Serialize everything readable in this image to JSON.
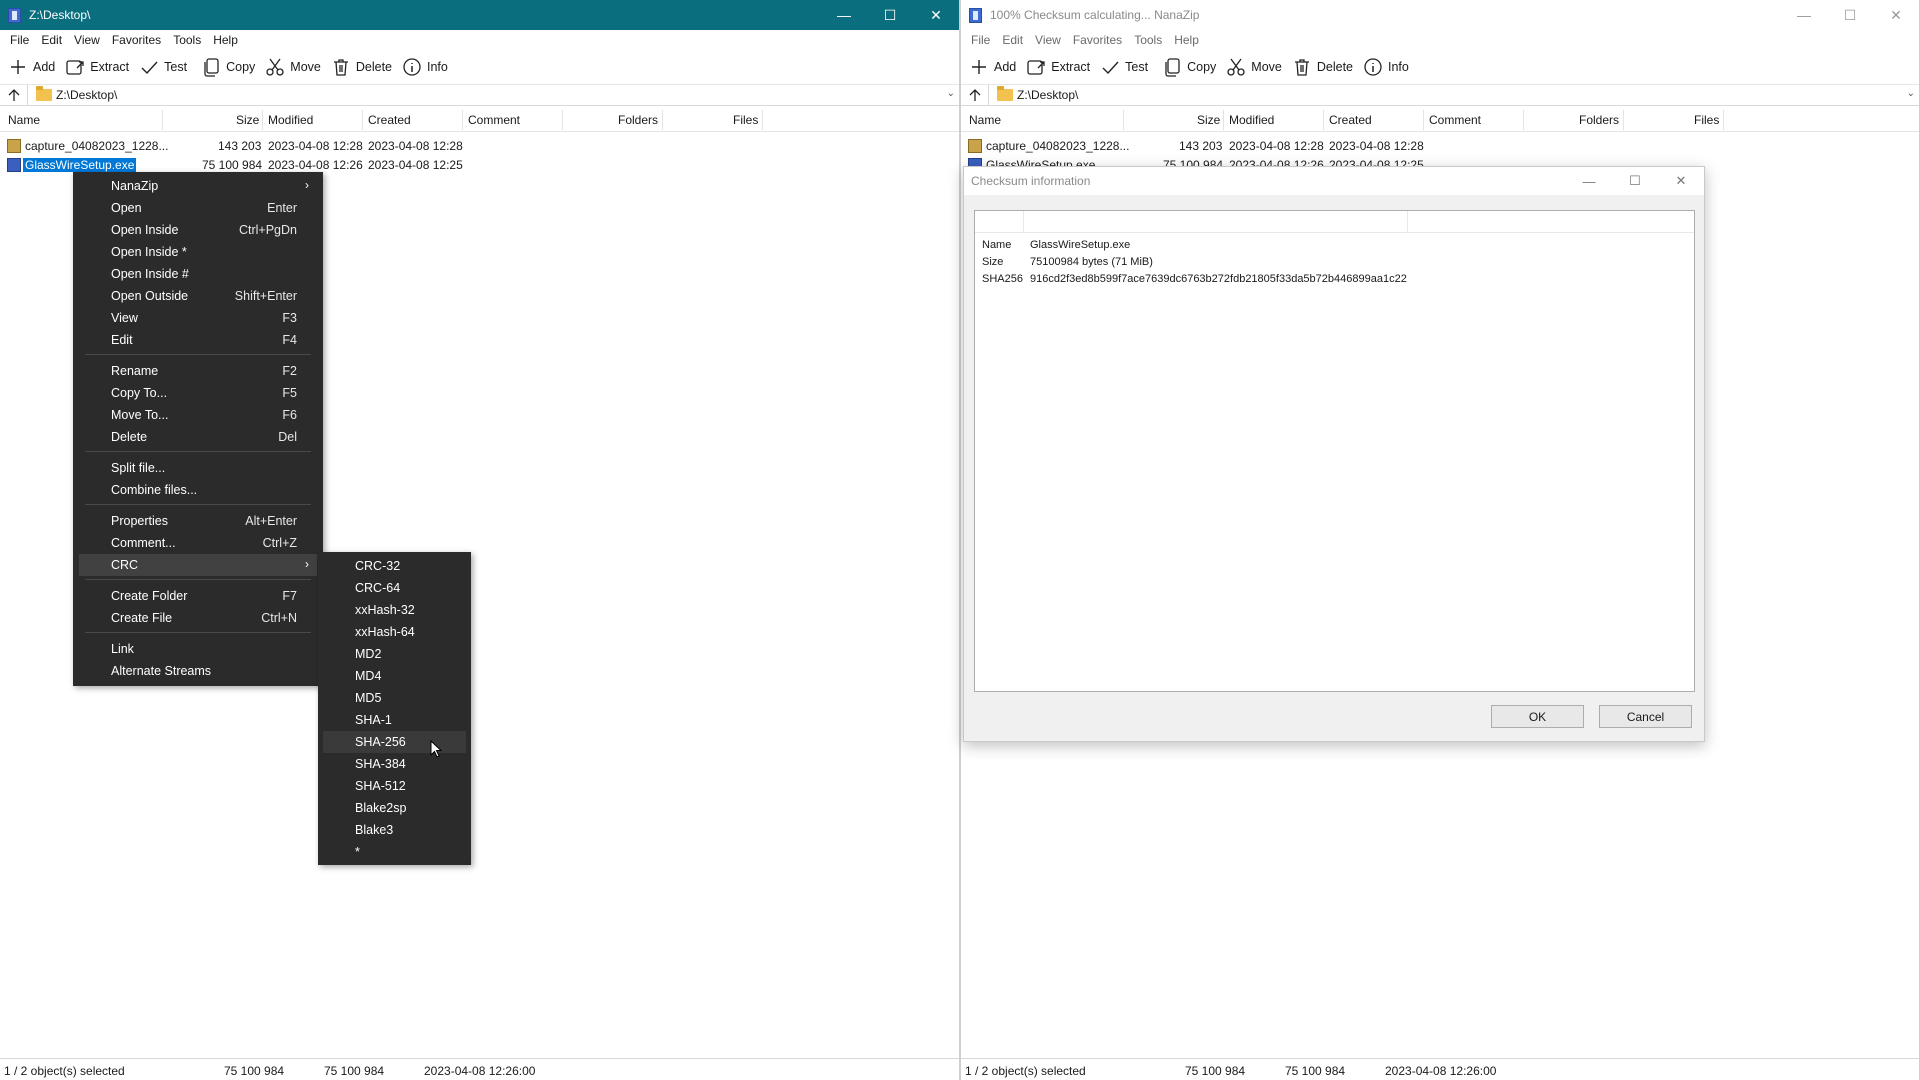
{
  "left_window": {
    "title": "Z:\\Desktop\\",
    "menu": [
      "File",
      "Edit",
      "View",
      "Favorites",
      "Tools",
      "Help"
    ],
    "toolbar": {
      "add": "Add",
      "extract": "Extract",
      "test": "Test",
      "copy": "Copy",
      "move": "Move",
      "delete": "Delete",
      "info": "Info"
    },
    "address": "Z:\\Desktop\\",
    "columns": {
      "name": "Name",
      "size": "Size",
      "modified": "Modified",
      "created": "Created",
      "comment": "Comment",
      "folders": "Folders",
      "files": "Files"
    },
    "files": [
      {
        "name": "capture_04082023_1228...",
        "size": "143 203",
        "modified": "2023-04-08 12:28",
        "created": "2023-04-08 12:28",
        "icon": "image-file-icon"
      },
      {
        "name": "GlassWireSetup.exe",
        "size": "75 100 984",
        "modified": "2023-04-08 12:26",
        "created": "2023-04-08 12:25",
        "icon": "exe-file-icon"
      }
    ],
    "status": {
      "selected": "1 / 2 object(s) selected",
      "size1": "75 100 984",
      "size2": "75 100 984",
      "date": "2023-04-08 12:26:00"
    }
  },
  "context_menu": {
    "items": [
      {
        "label": "NanaZip",
        "shortcut": "",
        "submenu": true
      },
      {
        "label": "Open",
        "shortcut": "Enter"
      },
      {
        "label": "Open Inside",
        "shortcut": "Ctrl+PgDn"
      },
      {
        "label": "Open Inside *",
        "shortcut": ""
      },
      {
        "label": "Open Inside #",
        "shortcut": ""
      },
      {
        "label": "Open Outside",
        "shortcut": "Shift+Enter"
      },
      {
        "label": "View",
        "shortcut": "F3"
      },
      {
        "label": "Edit",
        "shortcut": "F4"
      },
      {
        "label": "Rename",
        "shortcut": "F2"
      },
      {
        "label": "Copy To...",
        "shortcut": "F5"
      },
      {
        "label": "Move To...",
        "shortcut": "F6"
      },
      {
        "label": "Delete",
        "shortcut": "Del"
      },
      {
        "label": "Split file...",
        "shortcut": ""
      },
      {
        "label": "Combine files...",
        "shortcut": ""
      },
      {
        "label": "Properties",
        "shortcut": "Alt+Enter"
      },
      {
        "label": "Comment...",
        "shortcut": "Ctrl+Z"
      },
      {
        "label": "CRC",
        "shortcut": "",
        "submenu": true
      },
      {
        "label": "Create Folder",
        "shortcut": "F7"
      },
      {
        "label": "Create File",
        "shortcut": "Ctrl+N"
      },
      {
        "label": "Link",
        "shortcut": ""
      },
      {
        "label": "Alternate Streams",
        "shortcut": ""
      }
    ],
    "highlighted": "CRC"
  },
  "crc_submenu": {
    "items": [
      "CRC-32",
      "CRC-64",
      "xxHash-32",
      "xxHash-64",
      "MD2",
      "MD4",
      "MD5",
      "SHA-1",
      "SHA-256",
      "SHA-384",
      "SHA-512",
      "Blake2sp",
      "Blake3",
      "*"
    ],
    "highlighted": "SHA-256"
  },
  "right_window": {
    "title": "100% Checksum calculating... NanaZip",
    "menu": [
      "File",
      "Edit",
      "View",
      "Favorites",
      "Tools",
      "Help"
    ],
    "toolbar": {
      "add": "Add",
      "extract": "Extract",
      "test": "Test",
      "copy": "Copy",
      "move": "Move",
      "delete": "Delete",
      "info": "Info"
    },
    "address": "Z:\\Desktop\\",
    "columns": {
      "name": "Name",
      "size": "Size",
      "modified": "Modified",
      "created": "Created",
      "comment": "Comment",
      "folders": "Folders",
      "files": "Files"
    },
    "files": [
      {
        "name": "capture_04082023_1228...",
        "size": "143 203",
        "modified": "2023-04-08 12:28",
        "created": "2023-04-08 12:28"
      },
      {
        "name": "GlassWireSetup.exe",
        "size": "75 100 984",
        "modified": "2023-04-08 12:26",
        "created": "2023-04-08 12:25"
      }
    ],
    "status": {
      "selected": "1 / 2 object(s) selected",
      "size1": "75 100 984",
      "size2": "75 100 984",
      "date": "2023-04-08 12:26:00"
    }
  },
  "checksum_dialog": {
    "title": "Checksum information",
    "name_label": "Name",
    "name_value": "GlassWireSetup.exe",
    "size_label": "Size",
    "size_value": "75100984 bytes (71 MiB)",
    "hash_label": "SHA256",
    "hash_value": "916cd2f3ed8b599f7ace7639dc6763b272fdb21805f33da5b72b446899aa1c22",
    "ok": "OK",
    "cancel": "Cancel"
  },
  "colors": {
    "titlebar_active": "#0b6e7e",
    "selection": "#0078d7",
    "menu_bg": "#2b2b2b"
  }
}
